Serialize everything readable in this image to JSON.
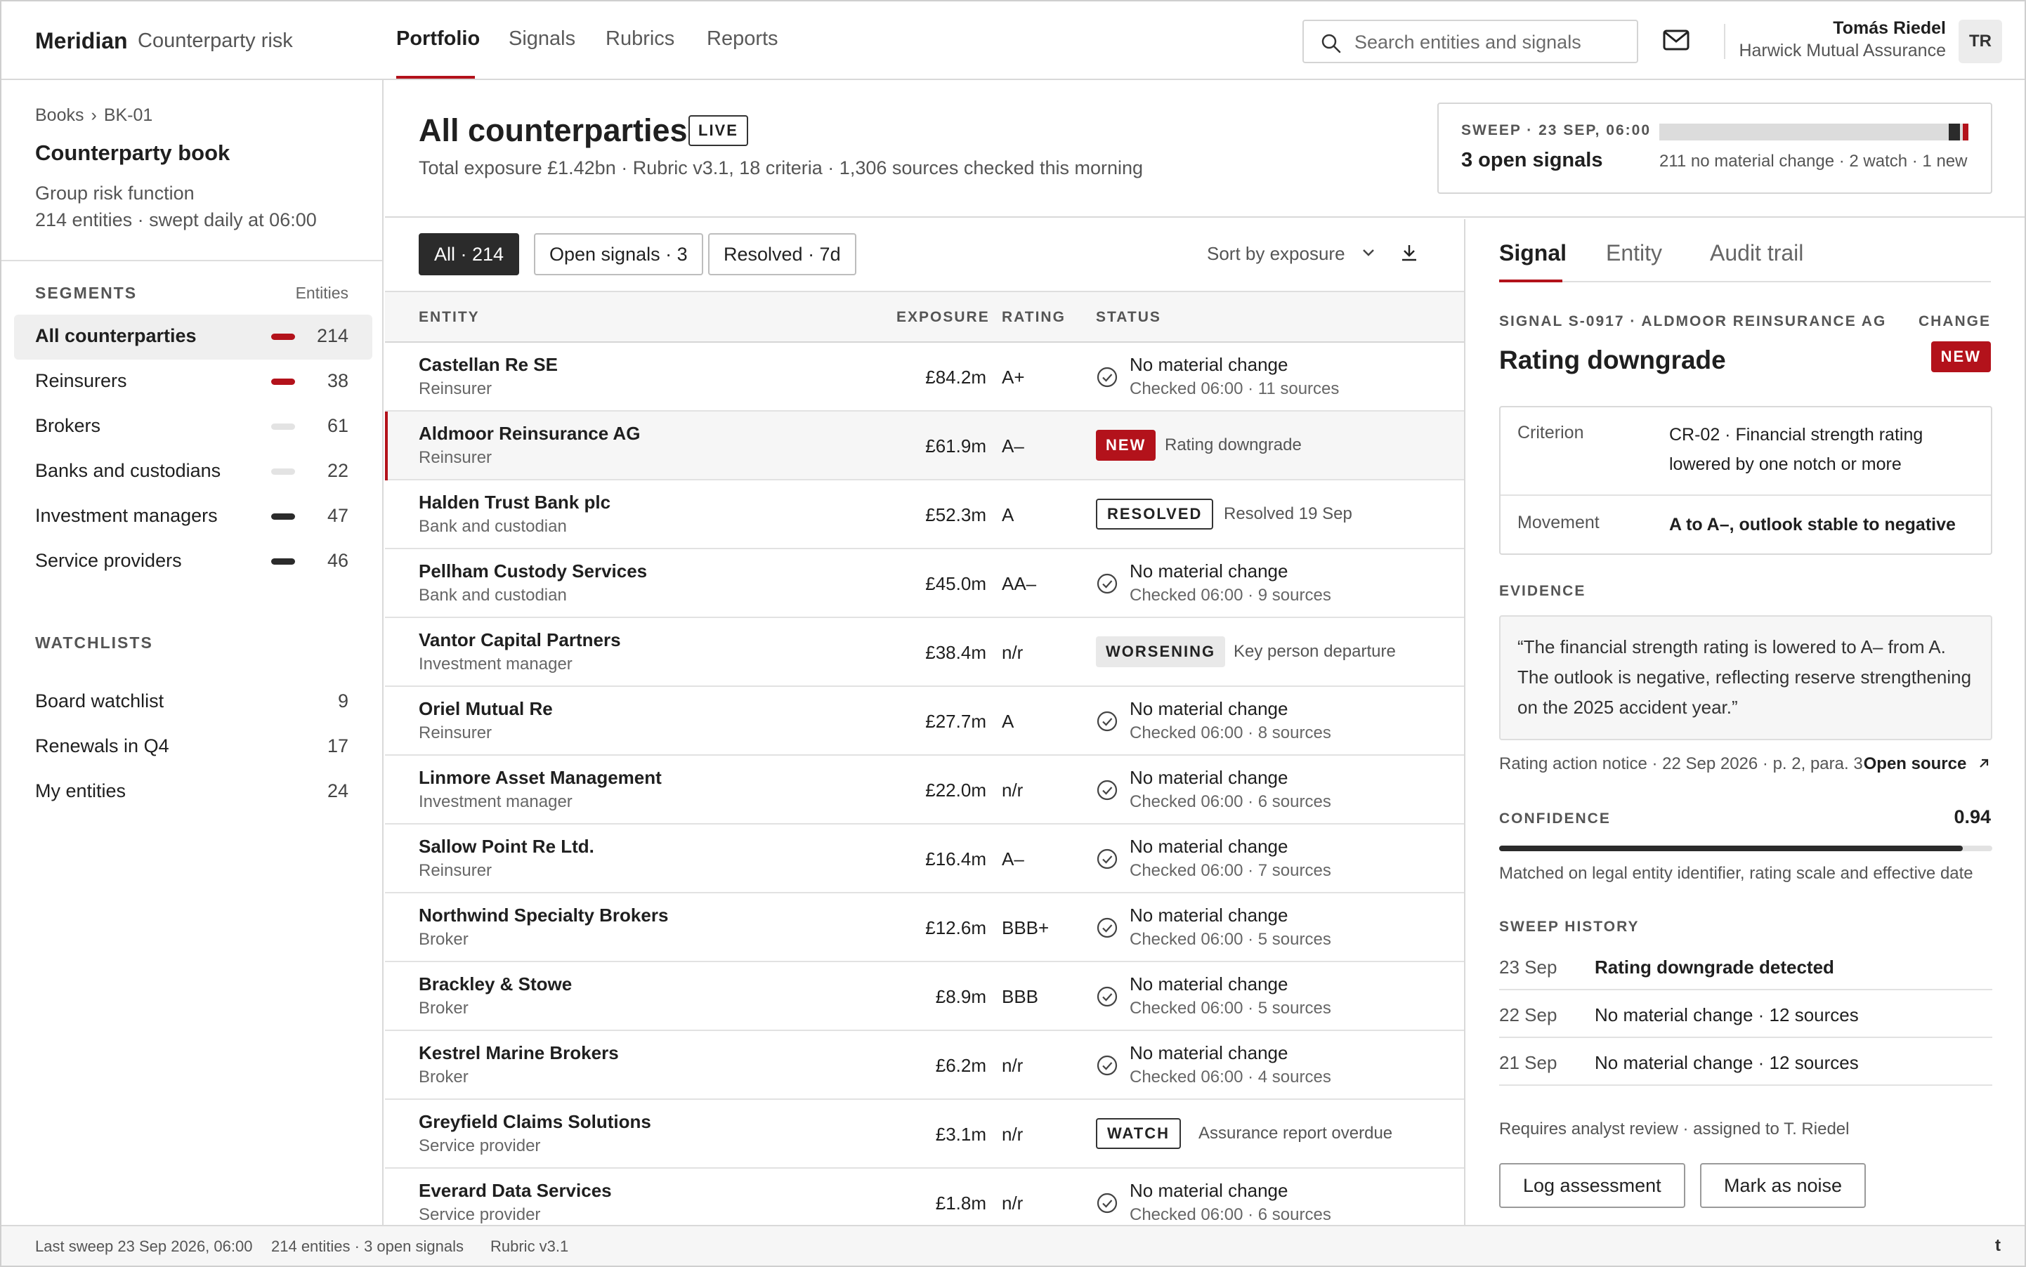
{
  "app": {
    "brand": "Meridian",
    "subtitle": "Counterparty risk"
  },
  "nav": {
    "tabs": [
      "Portfolio",
      "Signals",
      "Rubrics",
      "Reports"
    ],
    "active": "Portfolio"
  },
  "search": {
    "placeholder": "Search entities and signals"
  },
  "user": {
    "name": "Tomás Riedel",
    "org": "Harwick Mutual Assurance",
    "initials": "TR"
  },
  "sidebar": {
    "breadcrumb": [
      "Books",
      "BK-01"
    ],
    "title": "Counterparty book",
    "subtitle1": "Group risk function",
    "subtitle2": "214 entities · swept daily at 06:00",
    "segments_label": "SEGMENTS",
    "segments_aside": "Entities",
    "segments": [
      {
        "label": "All counterparties",
        "count": "214",
        "marker": "#b3121b"
      },
      {
        "label": "Reinsurers",
        "count": "38",
        "marker": "#b3121b"
      },
      {
        "label": "Brokers",
        "count": "61",
        "marker": "#e3e3e3"
      },
      {
        "label": "Banks and custodians",
        "count": "22",
        "marker": "#e3e3e3"
      },
      {
        "label": "Investment managers",
        "count": "47",
        "marker": "#2b2b2b"
      },
      {
        "label": "Service providers",
        "count": "46",
        "marker": "#2b2b2b"
      }
    ],
    "watchlists_label": "WATCHLISTS",
    "watchlists": [
      {
        "label": "Board watchlist",
        "count": "9"
      },
      {
        "label": "Renewals in Q4",
        "count": "17"
      },
      {
        "label": "My entities",
        "count": "24"
      }
    ]
  },
  "header": {
    "title": "All counterparties",
    "live": "LIVE",
    "summary": "Total exposure £1.42bn · Rubric v3.1, 18 criteria · 1,306 sources checked this morning"
  },
  "sweep": {
    "label": "SWEEP · 23 SEP, 06:00",
    "open": "3 open signals",
    "summary": "211 no material change · 2 watch · 1 new",
    "counts": {
      "no_change": 211,
      "watch": 2,
      "new": 1
    }
  },
  "filters": {
    "chips": [
      "All · 214",
      "Open signals · 3",
      "Resolved · 7d"
    ],
    "sort": "Sort by exposure"
  },
  "table": {
    "headers": {
      "entity": "ENTITY",
      "exposure": "EXPOSURE",
      "rating": "RATING",
      "status": "STATUS"
    },
    "rows": [
      {
        "name": "Castellan Re SE",
        "type": "Reinsurer",
        "exposure": "£84.2m",
        "rating": "A+",
        "kind": "ok",
        "status": "No material change",
        "detail": "Checked 06:00 · 11 sources"
      },
      {
        "name": "Aldmoor Reinsurance AG",
        "type": "Reinsurer",
        "exposure": "£61.9m",
        "rating": "A–",
        "kind": "new",
        "badge": "NEW",
        "status": "Rating downgrade",
        "selected": true
      },
      {
        "name": "Halden Trust Bank plc",
        "type": "Bank and custodian",
        "exposure": "£52.3m",
        "rating": "A",
        "kind": "resolved",
        "badge": "RESOLVED",
        "status": "Resolved 19 Sep"
      },
      {
        "name": "Pellham Custody Services",
        "type": "Bank and custodian",
        "exposure": "£45.0m",
        "rating": "AA–",
        "kind": "ok",
        "status": "No material change",
        "detail": "Checked 06:00 · 9 sources"
      },
      {
        "name": "Vantor Capital Partners",
        "type": "Investment manager",
        "exposure": "£38.4m",
        "rating": "n/r",
        "kind": "worsening",
        "badge": "WORSENING",
        "status": "Key person departure"
      },
      {
        "name": "Oriel Mutual Re",
        "type": "Reinsurer",
        "exposure": "£27.7m",
        "rating": "A",
        "kind": "ok",
        "status": "No material change",
        "detail": "Checked 06:00 · 8 sources"
      },
      {
        "name": "Linmore Asset Management",
        "type": "Investment manager",
        "exposure": "£22.0m",
        "rating": "n/r",
        "kind": "ok",
        "status": "No material change",
        "detail": "Checked 06:00 · 6 sources"
      },
      {
        "name": "Sallow Point Re Ltd.",
        "type": "Reinsurer",
        "exposure": "£16.4m",
        "rating": "A–",
        "kind": "ok",
        "status": "No material change",
        "detail": "Checked 06:00 · 7 sources"
      },
      {
        "name": "Northwind Specialty Brokers",
        "type": "Broker",
        "exposure": "£12.6m",
        "rating": "BBB+",
        "kind": "ok",
        "status": "No material change",
        "detail": "Checked 06:00 · 5 sources"
      },
      {
        "name": "Brackley & Stowe",
        "type": "Broker",
        "exposure": "£8.9m",
        "rating": "BBB",
        "kind": "ok",
        "status": "No material change",
        "detail": "Checked 06:00 · 5 sources"
      },
      {
        "name": "Kestrel Marine Brokers",
        "type": "Broker",
        "exposure": "£6.2m",
        "rating": "n/r",
        "kind": "ok",
        "status": "No material change",
        "detail": "Checked 06:00 · 4 sources"
      },
      {
        "name": "Greyfield Claims Solutions",
        "type": "Service provider",
        "exposure": "£3.1m",
        "rating": "n/r",
        "kind": "watch",
        "badge": "WATCH",
        "status": "Assurance report overdue"
      },
      {
        "name": "Everard Data Services",
        "type": "Service provider",
        "exposure": "£1.8m",
        "rating": "n/r",
        "kind": "ok",
        "status": "No material change",
        "detail": "Checked 06:00 · 6 sources"
      }
    ]
  },
  "detail": {
    "tabs": [
      "Signal",
      "Entity",
      "Audit trail"
    ],
    "meta": "SIGNAL S-0917 · ALDMOOR REINSURANCE AG",
    "change_label": "CHANGE",
    "title": "Rating downgrade",
    "badge": "NEW",
    "criterion_key": "Criterion",
    "criterion_val": "CR-02 · Financial strength rating lowered by one notch or more",
    "movement_key": "Movement",
    "movement_val": "A to A–, outlook stable to negative",
    "evidence_label": "EVIDENCE",
    "quote": "“The financial strength rating is lowered to A– from A. The outlook is negative, reflecting reserve strengthening on the 2025 accident year.”",
    "source": "Rating action notice · 22 Sep 2026 · p. 2, para. 3",
    "open_source": "Open source",
    "confidence_label": "CONFIDENCE",
    "confidence": "0.94",
    "confidence_value": 0.94,
    "confidence_note": "Matched on legal entity identifier, rating scale and effective date",
    "history_label": "SWEEP HISTORY",
    "history": [
      {
        "date": "23 Sep",
        "text": "Rating downgrade detected",
        "bold": true
      },
      {
        "date": "22 Sep",
        "text": "No material change · 12 sources"
      },
      {
        "date": "21 Sep",
        "text": "No material change · 12 sources"
      }
    ],
    "review_note": "Requires analyst review · assigned to T. Riedel",
    "actions": [
      "Log assessment",
      "Mark as noise"
    ]
  },
  "footer": {
    "last_sweep": "Last sweep 23 Sep 2026, 06:00",
    "counts": "214 entities · 3 open signals",
    "rubric": "Rubric v3.1",
    "logo": "t"
  },
  "colors": {
    "accent": "#b3121b",
    "dark": "#2b2b2b"
  }
}
